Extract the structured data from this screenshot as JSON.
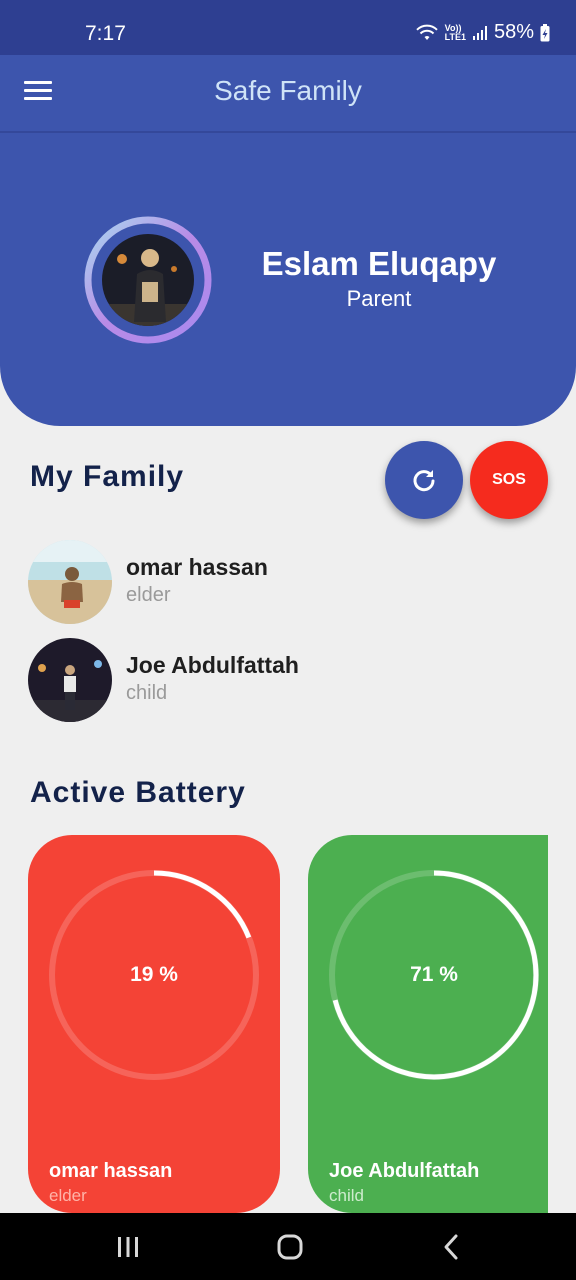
{
  "status_bar": {
    "time": "7:17",
    "network": "Vo))\nLTE1",
    "battery": "58%"
  },
  "app_bar": {
    "title": "Safe Family"
  },
  "profile": {
    "name": "Eslam Eluqapy",
    "role": "Parent"
  },
  "family": {
    "title": "My Family",
    "sos_label": "SOS",
    "members": [
      {
        "name": "omar hassan",
        "role": "elder"
      },
      {
        "name": "Joe Abdulfattah",
        "role": "child"
      }
    ]
  },
  "battery": {
    "title": "Active Battery",
    "cards": [
      {
        "name": "omar hassan",
        "role": "elder",
        "percent": 19,
        "label": "19 %",
        "color": "#f44336"
      },
      {
        "name": "Joe Abdulfattah",
        "role": "child",
        "percent": 71,
        "label": "71 %",
        "color": "#4caf50"
      }
    ]
  },
  "colors": {
    "primary": "#3d55ad",
    "status_bar": "#2e3f91",
    "sos": "#f52b1e",
    "title_text": "#13224a"
  }
}
